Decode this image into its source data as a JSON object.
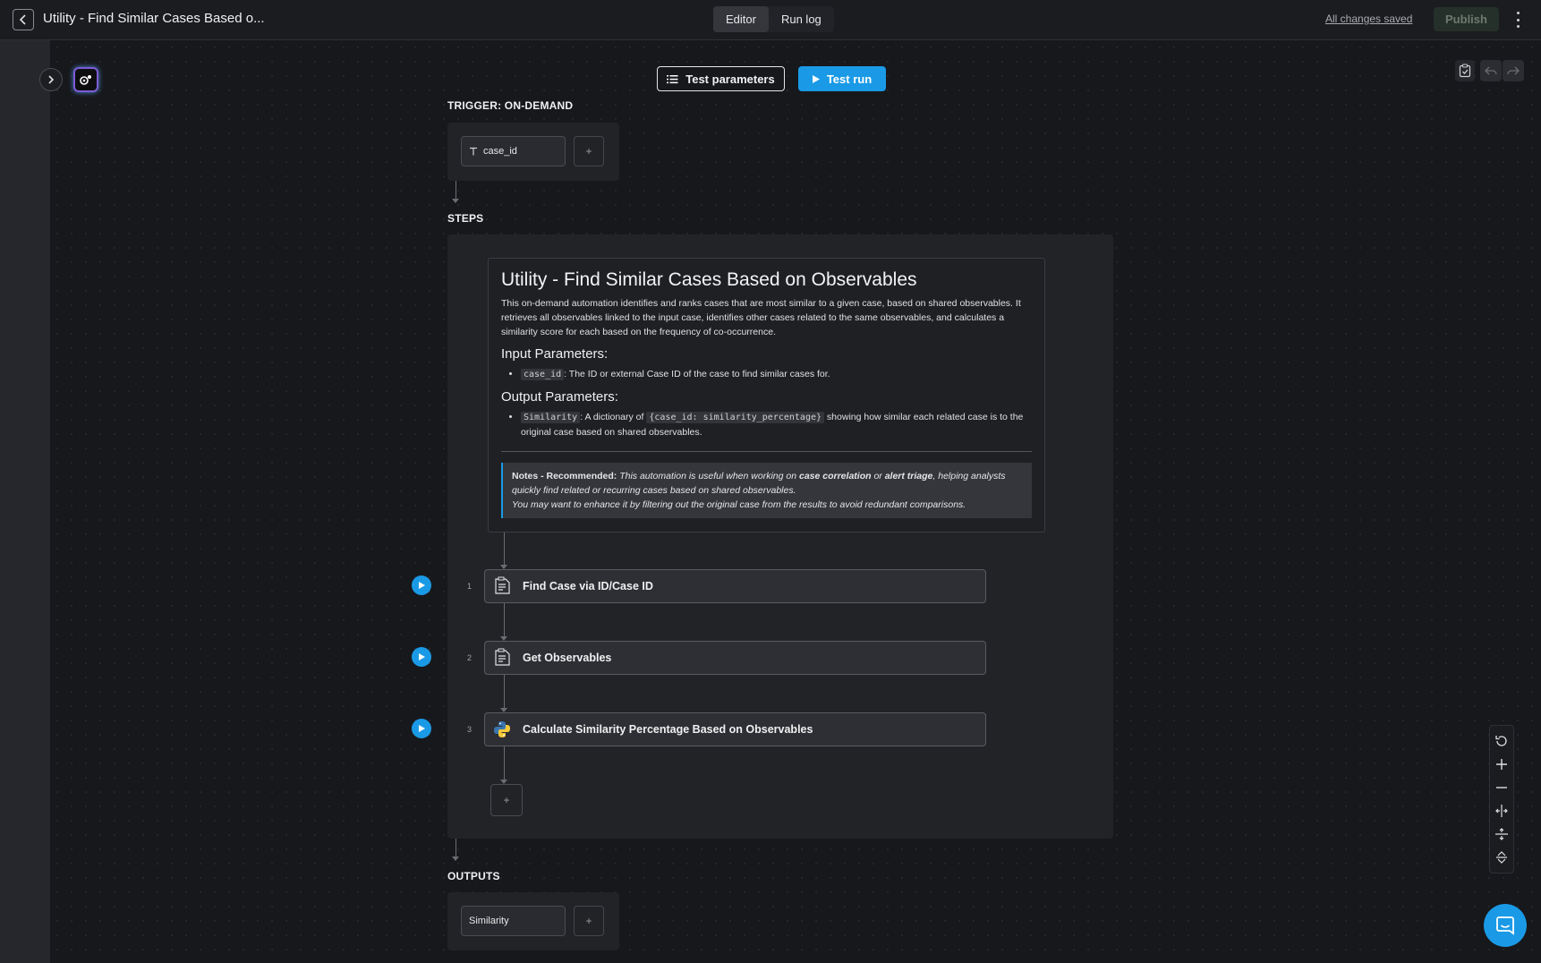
{
  "header": {
    "title": "Utility - Find Similar Cases Based o...",
    "tabs": [
      {
        "label": "Editor"
      },
      {
        "label": "Run log"
      }
    ],
    "status": "All changes saved",
    "publish_label": "Publish"
  },
  "toolbar": {
    "test_parameters_label": "Test parameters",
    "test_run_label": "Test run"
  },
  "trigger": {
    "label": "TRIGGER: ON-DEMAND",
    "params": [
      {
        "name": "case_id"
      }
    ],
    "add_label": "+"
  },
  "steps": {
    "label": "STEPS",
    "note": {
      "title": "Utility - Find Similar Cases Based on Observables",
      "description": "This on-demand automation identifies and ranks cases that are most similar to a given case, based on shared observables. It retrieves all observables linked to the input case, identifies other cases related to the same observables, and calculates a similarity score for each based on the frequency of co-occurrence.",
      "input_heading": "Input Parameters:",
      "input_code": "case_id",
      "input_text": ": The ID or external Case ID of the case to find similar cases for.",
      "output_heading": "Output Parameters:",
      "output_code1": "Similarity",
      "output_text1": ": A dictionary of ",
      "output_code2": "{case_id: similarity_percentage}",
      "output_text2": " showing how similar each related case is to the original case based on shared observables.",
      "notes_label": "Notes - Recommended:",
      "notes_text1": " This automation is useful when working on ",
      "notes_em1": "case correlation",
      "notes_text2": " or ",
      "notes_em2": "alert triage",
      "notes_text3": ", helping analysts quickly find related or recurring cases based on shared observables.",
      "notes_text4": "You may want to enhance it by filtering out the original case from the results to avoid redundant comparisons."
    },
    "items": [
      {
        "num": "1",
        "label": "Find Case via ID/Case ID",
        "icon": "document-icon"
      },
      {
        "num": "2",
        "label": "Get Observables",
        "icon": "document-icon"
      },
      {
        "num": "3",
        "label": "Calculate Similarity Percentage Based on Observables",
        "icon": "python-icon"
      }
    ],
    "add_label": "+"
  },
  "outputs": {
    "label": "OUTPUTS",
    "params": [
      {
        "name": "Similarity"
      }
    ],
    "add_label": "+"
  },
  "colors": {
    "accent": "#1a9ae6",
    "background": "#17181c"
  }
}
